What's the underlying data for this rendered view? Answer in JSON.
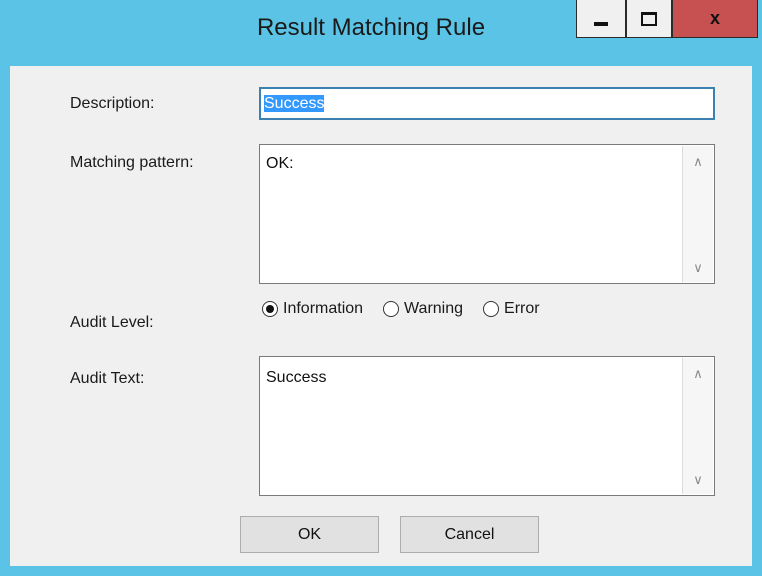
{
  "window": {
    "title": "Result Matching Rule",
    "controls": {
      "minimize": "minimize",
      "maximize": "maximize",
      "close_label": "x"
    }
  },
  "form": {
    "description_label": "Description:",
    "description_value": "Success",
    "matching_pattern_label": "Matching pattern:",
    "matching_pattern_value": "OK:",
    "audit_level_label": "Audit Level:",
    "audit_level_options": [
      "Information",
      "Warning",
      "Error"
    ],
    "audit_level_selected": "Information",
    "audit_text_label": "Audit Text:",
    "audit_text_value": "Success"
  },
  "buttons": {
    "ok_label": "OK",
    "cancel_label": "Cancel"
  },
  "icons": {
    "scroll_up": "chevron-up-icon",
    "scroll_down": "chevron-down-icon"
  }
}
